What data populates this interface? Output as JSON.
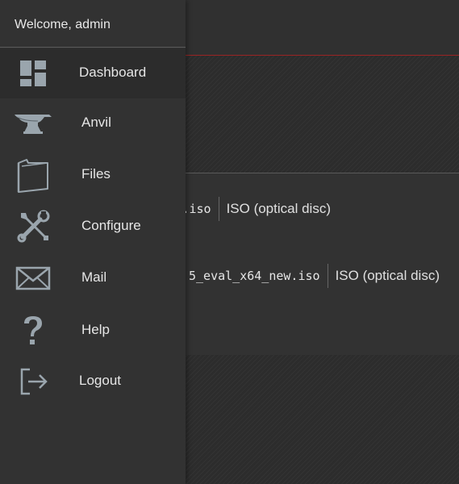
{
  "drawer": {
    "welcome": "Welcome, admin",
    "items": [
      {
        "label": "Dashboard",
        "icon": "dashboard-icon"
      },
      {
        "label": "Anvil",
        "icon": "anvil-icon"
      },
      {
        "label": "Files",
        "icon": "folder-icon"
      },
      {
        "label": "Configure",
        "icon": "wrench-screwdriver-icon"
      },
      {
        "label": "Mail",
        "icon": "mail-icon"
      },
      {
        "label": "Help",
        "icon": "help-icon"
      },
      {
        "label": "Logout",
        "icon": "logout-icon"
      }
    ]
  },
  "files": [
    {
      "name": ".iso",
      "type": "ISO (optical disc)"
    },
    {
      "name": "5_eval_x64_new.iso",
      "type": "ISO (optical disc)"
    }
  ],
  "colors": {
    "drawer_bg": "#323232",
    "icon": "#9aa5ad",
    "accent_line": "#9a2424"
  }
}
